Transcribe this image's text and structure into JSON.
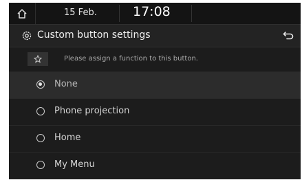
{
  "status_bar": {
    "date": "15 Feb.",
    "time": "17:08"
  },
  "header": {
    "title": "Custom button settings"
  },
  "instruction": {
    "text": "Please assign a function to this button."
  },
  "options": [
    {
      "label": "None",
      "selected": true
    },
    {
      "label": "Phone projection",
      "selected": false
    },
    {
      "label": "Home",
      "selected": false
    },
    {
      "label": "My Menu",
      "selected": false
    }
  ]
}
